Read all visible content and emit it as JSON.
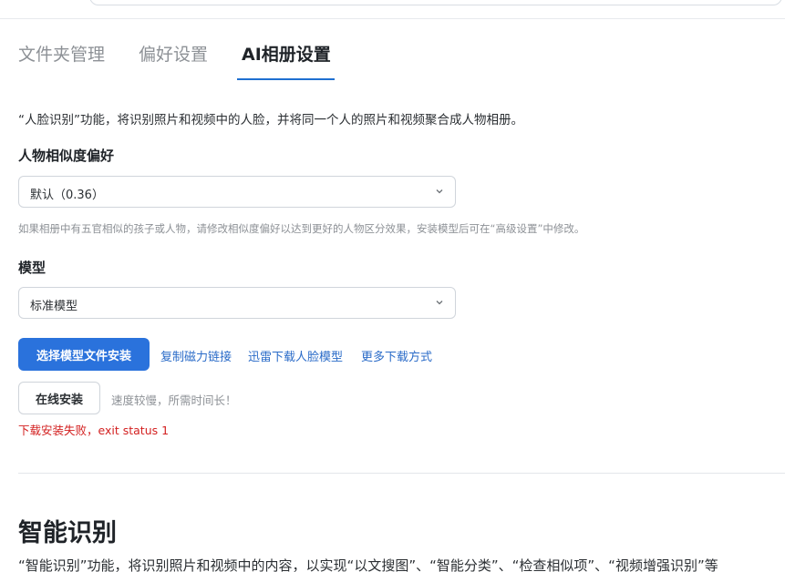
{
  "tabs": [
    {
      "label": "文件夹管理"
    },
    {
      "label": "偏好设置"
    },
    {
      "label": "AI相册设置"
    }
  ],
  "face": {
    "description": "“人脸识别”功能，将识别照片和视频中的人脸，并将同一个人的照片和视频聚合成人物相册。",
    "similarity_label": "人物相似度偏好",
    "similarity_value": "默认（0.36）",
    "similarity_hint": "如果相册中有五官相似的孩子或人物，请修改相似度偏好以达到更好的人物区分效果，安装模型后可在“高级设置”中修改。",
    "model_label": "模型",
    "model_value": "标准模型",
    "choose_file_button": "选择模型文件安装",
    "links": [
      "复制磁力链接",
      "迅雷下载人脸模型",
      "更多下载方式"
    ],
    "online_install_button": "在线安装",
    "online_note": "速度较慢，所需时间长！",
    "error_text": "下载安装失败，exit status 1"
  },
  "smart": {
    "title": "智能识别",
    "description": "“智能识别”功能，将识别照片和视频中的内容，以实现“以文搜图”、“智能分类”、“检查相似项”、“视频增强识别”等"
  },
  "colors": {
    "accent": "#2a72dc",
    "error": "#d32020"
  }
}
